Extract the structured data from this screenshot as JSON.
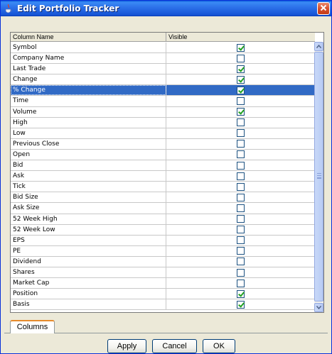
{
  "window": {
    "title": "Edit Portfolio Tracker",
    "icons": {
      "app": "java-cup-icon",
      "close": "close-icon"
    }
  },
  "table": {
    "headers": {
      "name": "Column Name",
      "visible": "Visible"
    },
    "selected_index": 4,
    "rows": [
      {
        "name": "Symbol",
        "visible": true
      },
      {
        "name": "Company Name",
        "visible": false
      },
      {
        "name": "Last Trade",
        "visible": true
      },
      {
        "name": "Change",
        "visible": true
      },
      {
        "name": "% Change",
        "visible": true
      },
      {
        "name": "Time",
        "visible": false
      },
      {
        "name": "Volume",
        "visible": true
      },
      {
        "name": "High",
        "visible": false
      },
      {
        "name": "Low",
        "visible": false
      },
      {
        "name": "Previous Close",
        "visible": false
      },
      {
        "name": "Open",
        "visible": false
      },
      {
        "name": "Bid",
        "visible": false
      },
      {
        "name": "Ask",
        "visible": false
      },
      {
        "name": "Tick",
        "visible": false
      },
      {
        "name": "Bid Size",
        "visible": false
      },
      {
        "name": "Ask Size",
        "visible": false
      },
      {
        "name": "52 Week High",
        "visible": false
      },
      {
        "name": "52 Week Low",
        "visible": false
      },
      {
        "name": "EPS",
        "visible": false
      },
      {
        "name": "PE",
        "visible": false
      },
      {
        "name": "Dividend",
        "visible": false
      },
      {
        "name": "Shares",
        "visible": false
      },
      {
        "name": "Market Cap",
        "visible": false
      },
      {
        "name": "Position",
        "visible": true
      },
      {
        "name": "Basis",
        "visible": true
      }
    ]
  },
  "tabs": [
    {
      "label": "Columns",
      "active": true
    }
  ],
  "buttons": {
    "apply": "Apply",
    "cancel": "Cancel",
    "ok": "OK"
  },
  "colors": {
    "titlebar": "#2b6fe8",
    "selection": "#316ac5",
    "check": "#21a121",
    "tab_accent": "#e68b2c"
  }
}
